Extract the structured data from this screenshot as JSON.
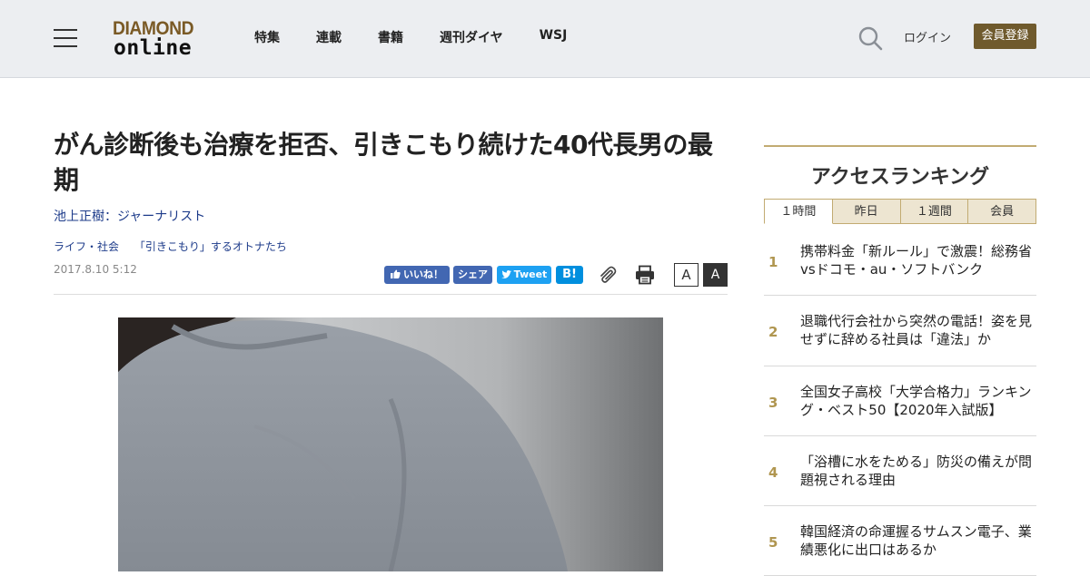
{
  "header": {
    "logo_top": "DIAMOND",
    "logo_bottom": "online",
    "nav": [
      "特集",
      "連載",
      "書籍",
      "週刊ダイヤ",
      "WSJ"
    ],
    "login": "ログイン",
    "register": "会員登録"
  },
  "article": {
    "title": "がん診断後も治療を拒否、引きこもり続けた40代長男の最期",
    "author": "池上正樹：ジャーナリスト",
    "categories": [
      "ライフ・社会",
      "「引きこもり」するオトナたち"
    ],
    "date": "2017.8.10 5:12",
    "share": {
      "like": "いいね！",
      "fb_share": "シェア",
      "tweet": "Tweet",
      "hatena": "B!"
    },
    "font_small": "A",
    "font_large": "A"
  },
  "sidebar": {
    "title": "アクセスランキング",
    "tabs": [
      "１時間",
      "昨日",
      "１週間",
      "会員"
    ],
    "ranking": [
      {
        "num": "1",
        "text": "携帯料金「新ルール」で激震！総務省vsドコモ・au・ソフトバンク"
      },
      {
        "num": "2",
        "text": "退職代行会社から突然の電話！姿を見せずに辞める社員は「違法」か"
      },
      {
        "num": "3",
        "text": "全国女子高校「大学合格力」ランキング・ベスト50【2020年入試版】"
      },
      {
        "num": "4",
        "text": "「浴槽に水をためる」防災の備えが問題視される理由"
      },
      {
        "num": "5",
        "text": "韓国経済の命運握るサムスン電子、業績悪化に出口はあるか"
      }
    ]
  },
  "colors": {
    "header_bg": "#eceef1",
    "brand_gold": "#6f5a2d",
    "rank_accent": "#b09650",
    "link_blue": "#1d3b8a",
    "facebook": "#4267b2",
    "twitter": "#1da1f2",
    "hatena": "#008fde"
  },
  "icons": [
    "hamburger-icon",
    "search-icon",
    "thumbs-up-icon",
    "twitter-bird-icon",
    "paperclip-icon",
    "printer-icon"
  ]
}
